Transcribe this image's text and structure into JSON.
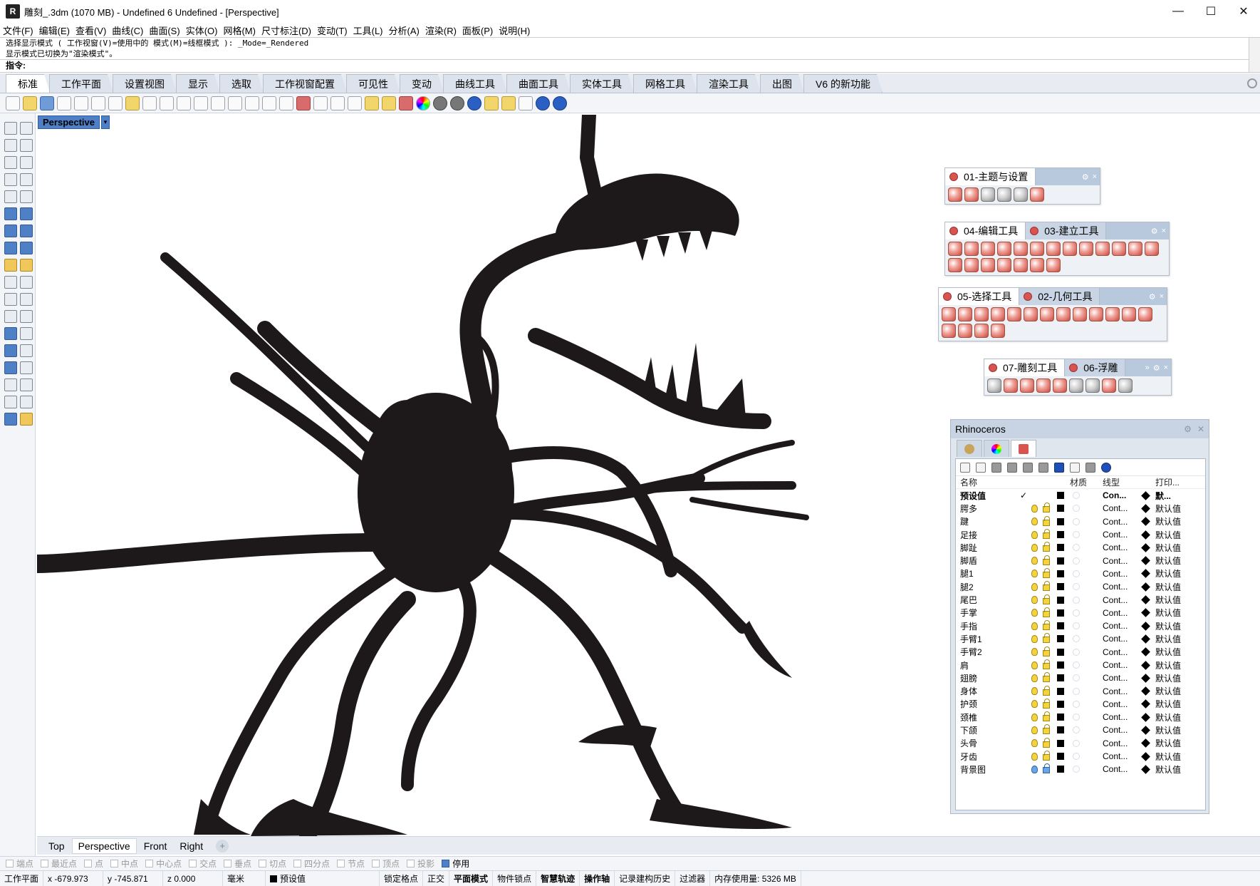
{
  "window": {
    "title": "雕刻_.3dm (1070 MB) - Undefined 6 Undefined - [Perspective]",
    "app_icon": "rhino-icon",
    "minimize": "—",
    "maximize": "☐",
    "close": "✕"
  },
  "menu": [
    "文件(F)",
    "编辑(E)",
    "查看(V)",
    "曲线(C)",
    "曲面(S)",
    "实体(O)",
    "网格(M)",
    "尺寸标注(D)",
    "变动(T)",
    "工具(L)",
    "分析(A)",
    "渲染(R)",
    "面板(P)",
    "说明(H)"
  ],
  "command": {
    "line1": "选择显示模式 ( 工作视窗(V)=使用中的  模式(M)=线框模式 ): _Mode=_Rendered",
    "line2": "显示模式已切换为\"渲染模式\"。",
    "prompt": "指令:",
    "input": ""
  },
  "tabs": [
    "标准",
    "工作平面",
    "设置视图",
    "显示",
    "选取",
    "工作视窗配置",
    "可见性",
    "变动",
    "曲线工具",
    "曲面工具",
    "实体工具",
    "网格工具",
    "渲染工具",
    "出图",
    "V6 的新功能"
  ],
  "viewport": {
    "label": "Perspective",
    "menu_arrow": "▾"
  },
  "panels": {
    "p1": {
      "tab1": "01-主题与设置"
    },
    "p2": {
      "tab1": "04-编辑工具",
      "tab2": "03-建立工具"
    },
    "p3": {
      "tab1": "05-选择工具",
      "tab2": "02-几何工具"
    },
    "p4": {
      "tab1": "07-雕刻工具",
      "tab2": "06-浮雕",
      "more": "»"
    }
  },
  "layers": {
    "panel_title": "Rhinoceros",
    "columns": {
      "name": "名称",
      "material": "材质",
      "linetype": "线型",
      "print": "打印..."
    },
    "default_row": {
      "name": "预设值",
      "current": "✓",
      "linetype": "Con...",
      "print": "默..."
    },
    "rows": [
      {
        "name": "腭多",
        "linetype": "Cont...",
        "print": "默认值"
      },
      {
        "name": "踺",
        "linetype": "Cont...",
        "print": "默认值"
      },
      {
        "name": "足接",
        "linetype": "Cont...",
        "print": "默认值"
      },
      {
        "name": "脚趾",
        "linetype": "Cont...",
        "print": "默认值"
      },
      {
        "name": "脚盾",
        "linetype": "Cont...",
        "print": "默认值"
      },
      {
        "name": "腿1",
        "linetype": "Cont...",
        "print": "默认值"
      },
      {
        "name": "腿2",
        "linetype": "Cont...",
        "print": "默认值"
      },
      {
        "name": "尾巴",
        "linetype": "Cont...",
        "print": "默认值"
      },
      {
        "name": "手掌",
        "linetype": "Cont...",
        "print": "默认值"
      },
      {
        "name": "手指",
        "linetype": "Cont...",
        "print": "默认值"
      },
      {
        "name": "手臂1",
        "linetype": "Cont...",
        "print": "默认值"
      },
      {
        "name": "手臂2",
        "linetype": "Cont...",
        "print": "默认值"
      },
      {
        "name": "肩",
        "linetype": "Cont...",
        "print": "默认值"
      },
      {
        "name": "翅膀",
        "linetype": "Cont...",
        "print": "默认值"
      },
      {
        "name": "身体",
        "linetype": "Cont...",
        "print": "默认值"
      },
      {
        "name": "护颈",
        "linetype": "Cont...",
        "print": "默认值"
      },
      {
        "name": "颈椎",
        "linetype": "Cont...",
        "print": "默认值"
      },
      {
        "name": "下颌",
        "linetype": "Cont...",
        "print": "默认值"
      },
      {
        "name": "头骨",
        "linetype": "Cont...",
        "print": "默认值"
      },
      {
        "name": "牙齿",
        "linetype": "Cont...",
        "print": "默认值"
      },
      {
        "name": "背景图",
        "linetype": "Cont...",
        "print": "默认值",
        "blue": true
      }
    ]
  },
  "viewtabs": [
    "Top",
    "Perspective",
    "Front",
    "Right"
  ],
  "viewtab_active": "Perspective",
  "viewtab_add": "+",
  "osnaps": [
    {
      "label": "端点",
      "on": false
    },
    {
      "label": "最近点",
      "on": false
    },
    {
      "label": "点",
      "on": false
    },
    {
      "label": "中点",
      "on": false
    },
    {
      "label": "中心点",
      "on": false
    },
    {
      "label": "交点",
      "on": false
    },
    {
      "label": "垂点",
      "on": false
    },
    {
      "label": "切点",
      "on": false
    },
    {
      "label": "四分点",
      "on": false
    },
    {
      "label": "节点",
      "on": false
    },
    {
      "label": "顶点",
      "on": false
    },
    {
      "label": "投影",
      "on": false
    },
    {
      "label": "停用",
      "on": true
    }
  ],
  "status": {
    "cplane": "工作平面",
    "x": "x -679.973",
    "y": "y -745.871",
    "z": "z 0.000",
    "units": "毫米",
    "layer": "预设值",
    "grid_snap": "锁定格点",
    "ortho": "正交",
    "planar": "平面模式",
    "osnap": "物件锁点",
    "smarttrack": "智慧轨迹",
    "gumball": "操作轴",
    "history": "记录建构历史",
    "filter": "过滤器",
    "memory": "内存使用量: 5326 MB"
  },
  "colors": {
    "accent": "#4f80c7",
    "model": "#1d191a",
    "panel_bg": "#eef1f5"
  }
}
